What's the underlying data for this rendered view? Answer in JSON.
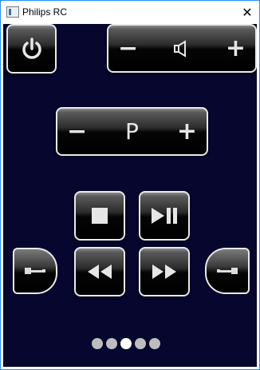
{
  "window": {
    "title": "Philips RC",
    "close_label": "✕"
  },
  "remote": {
    "power_glyph": "⏻",
    "volume": {
      "minus": "−",
      "speaker": "🔈",
      "plus": "+"
    },
    "program": {
      "minus": "−",
      "label": "P",
      "plus": "+"
    },
    "transport": {
      "stop": "■",
      "play_pause": "▶❚❚",
      "rewind": "◀◀",
      "fast_forward": "▶▶"
    },
    "pages": {
      "count": 5,
      "active_index": 2
    }
  },
  "colors": {
    "background": "#06062e",
    "accent_border": "#e9e9e9"
  }
}
